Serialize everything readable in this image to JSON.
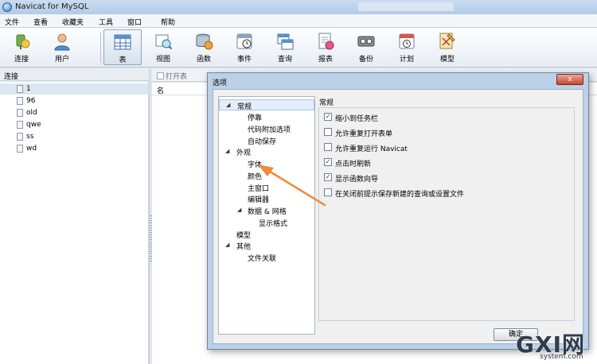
{
  "app": {
    "title": "Navicat for MySQL"
  },
  "menu": [
    "文件",
    "查看",
    "收藏夹",
    "工具",
    "窗口",
    "帮助"
  ],
  "toolbar": [
    {
      "label": "连接",
      "icon": "connection-icon"
    },
    {
      "label": "用户",
      "icon": "user-icon"
    },
    {
      "label": "表",
      "icon": "table-icon",
      "active": true
    },
    {
      "label": "视图",
      "icon": "view-icon"
    },
    {
      "label": "函数",
      "icon": "function-icon"
    },
    {
      "label": "事件",
      "icon": "event-icon"
    },
    {
      "label": "查询",
      "icon": "query-icon"
    },
    {
      "label": "报表",
      "icon": "report-icon"
    },
    {
      "label": "备份",
      "icon": "backup-icon"
    },
    {
      "label": "计划",
      "icon": "schedule-icon"
    },
    {
      "label": "模型",
      "icon": "model-icon"
    }
  ],
  "connections": {
    "header": "连接",
    "items": [
      "1",
      "96",
      "old",
      "qwe",
      "ss",
      "wd"
    ]
  },
  "objects": {
    "toolbar": [
      "打开表"
    ],
    "column_header": "名"
  },
  "dialog": {
    "title": "选项",
    "close_label": "x",
    "tree": [
      {
        "label": "常规",
        "level": 0,
        "expanded": true,
        "selected": true
      },
      {
        "label": "停靠",
        "level": 1
      },
      {
        "label": "代码附加选项",
        "level": 1
      },
      {
        "label": "自动保存",
        "level": 1
      },
      {
        "label": "外观",
        "level": 0,
        "expanded": true
      },
      {
        "label": "字体",
        "level": 1
      },
      {
        "label": "颜色",
        "level": 1
      },
      {
        "label": "主窗口",
        "level": 1
      },
      {
        "label": "编辑器",
        "level": 1
      },
      {
        "label": "数据 & 网格",
        "level": 1,
        "expanded": true
      },
      {
        "label": "显示格式",
        "level": 2
      },
      {
        "label": "模型",
        "level": 0
      },
      {
        "label": "其他",
        "level": 0,
        "expanded": true
      },
      {
        "label": "文件关联",
        "level": 1
      }
    ],
    "section_title": "常规",
    "options": [
      {
        "label": "缩小到任务栏",
        "checked": true
      },
      {
        "label": "允许重复打开表单",
        "checked": false
      },
      {
        "label": "允许重复运行 Navicat",
        "checked": false
      },
      {
        "label": "点击时刷新",
        "checked": true
      },
      {
        "label": "显示函数向导",
        "checked": true
      },
      {
        "label": "在关闭前提示保存新建的查询或设置文件",
        "checked": false
      }
    ],
    "ok_label": "确定"
  },
  "watermark": {
    "brand": "GXI网",
    "site": "system.com"
  },
  "colors": {
    "accent_arrow": "#f08a3c",
    "selection": "#dbe6f2",
    "dialog_frame": "#bcd0e8"
  }
}
